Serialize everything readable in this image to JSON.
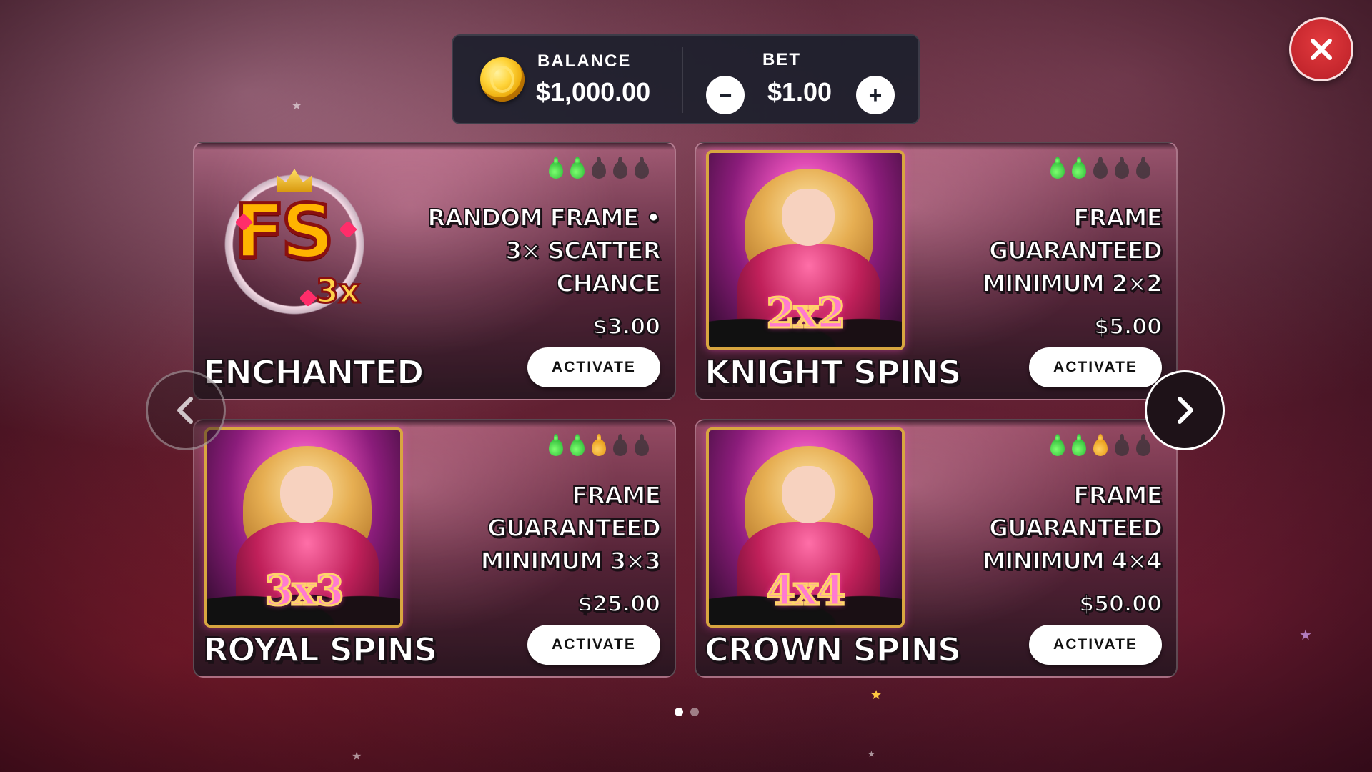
{
  "balance": {
    "label": "BALANCE",
    "value": "$1,000.00"
  },
  "bet": {
    "label": "BET",
    "value": "$1.00",
    "minus_label": "−",
    "plus_label": "+"
  },
  "cards": [
    {
      "title": "ENCHANTED",
      "description": "RANDOM FRAME • 3× SCATTER CHANCE",
      "price": "$3.00",
      "button": "ACTIVATE",
      "volatility": [
        "green",
        "green",
        "empty",
        "empty",
        "empty"
      ],
      "art_icon": "fs-3x-logo",
      "logo_main": "FS",
      "logo_sub": "3x"
    },
    {
      "title": "KNIGHT SPINS",
      "description": "FRAME GUARANTEED MINIMUM 2×2",
      "price": "$5.00",
      "button": "ACTIVATE",
      "volatility": [
        "green",
        "green",
        "empty",
        "empty",
        "empty"
      ],
      "art_icon": "queen-2x2-art",
      "badge": "2x2"
    },
    {
      "title": "ROYAL SPINS",
      "description": "FRAME GUARANTEED MINIMUM 3×3",
      "price": "$25.00",
      "button": "ACTIVATE",
      "volatility": [
        "green",
        "green",
        "orange",
        "empty",
        "empty"
      ],
      "art_icon": "queen-3x3-art",
      "badge": "3x3"
    },
    {
      "title": "CROWN SPINS",
      "description": "FRAME GUARANTEED MINIMUM 4×4",
      "price": "$50.00",
      "button": "ACTIVATE",
      "volatility": [
        "green",
        "green",
        "orange",
        "empty",
        "empty"
      ],
      "art_icon": "queen-4x4-art",
      "badge": "4x4"
    }
  ],
  "pagination": {
    "pages": 2,
    "current": 1
  },
  "icons": {
    "close": "close-icon",
    "prev": "chevron-left-icon",
    "next": "chevron-right-icon",
    "coin": "coin-icon"
  },
  "colors": {
    "close_red": "#c8252c",
    "panel": "#1c202c",
    "coin_gold": "#ffc828"
  }
}
